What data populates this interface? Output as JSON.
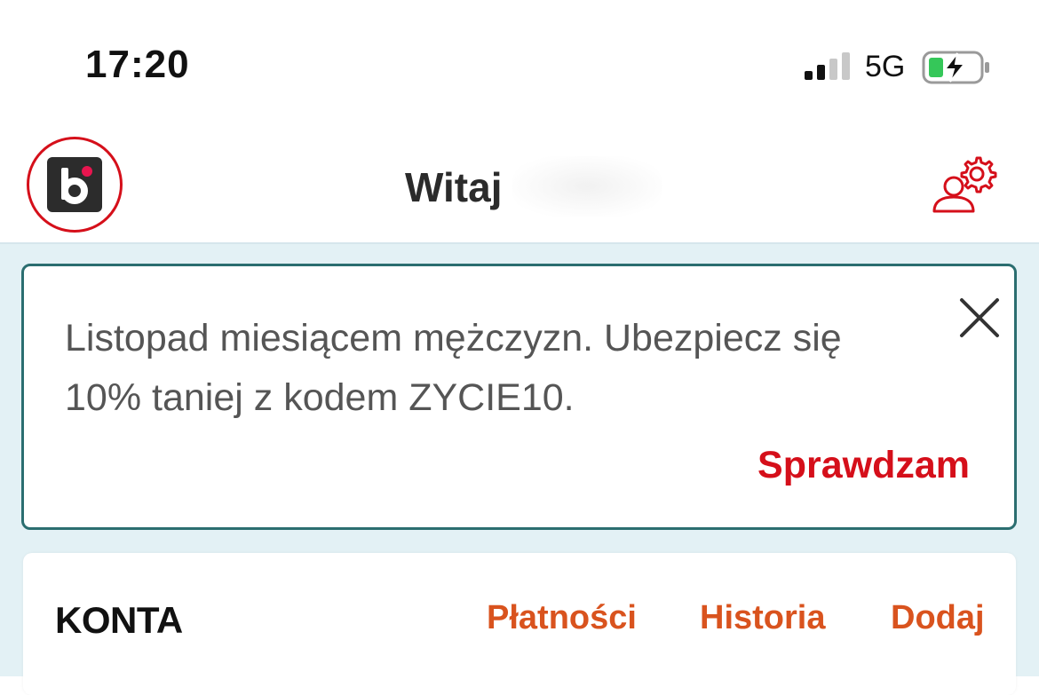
{
  "status_bar": {
    "time": "17:20",
    "network": "5G",
    "icons": [
      "signal-icon",
      "battery-charging-icon"
    ]
  },
  "header": {
    "greeting": "Witaj",
    "logo_icon": "bank-logo-icon",
    "settings_icon": "profile-settings-icon"
  },
  "promo": {
    "text": "Listopad miesiącem mężczyzn. Ubezpiecz się 10% taniej z kodem ZYCIE10.",
    "cta_label": "Sprawdzam",
    "close_icon": "close-icon"
  },
  "accounts": {
    "title": "KONTA",
    "links": {
      "payments": "Płatności",
      "history": "Historia",
      "add": "Dodaj"
    }
  },
  "colors": {
    "brand_red": "#d50f1a",
    "link_orange": "#d9531e",
    "promo_border": "#2b6e70",
    "content_bg": "#e3f1f5"
  }
}
